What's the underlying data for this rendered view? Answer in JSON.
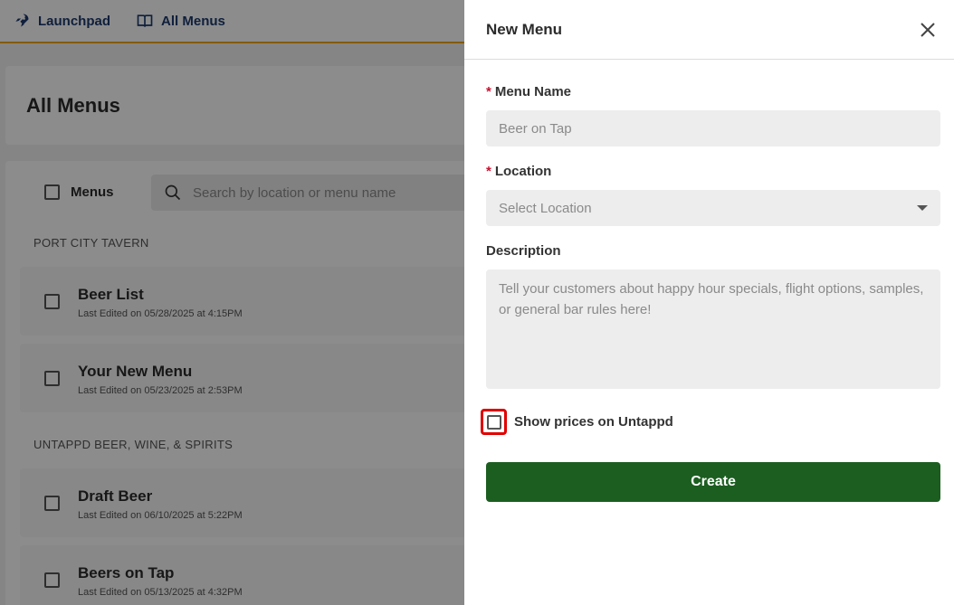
{
  "nav": {
    "launchpad_label": "Launchpad",
    "all_menus_label": "All Menus"
  },
  "page": {
    "title": "All Menus"
  },
  "list": {
    "select_all_label": "Menus",
    "search_placeholder": "Search by location or menu name",
    "groups": [
      {
        "label": "PORT CITY TAVERN",
        "menus": [
          {
            "name": "Beer List",
            "edited": "Last Edited on 05/28/2025 at 4:15PM"
          },
          {
            "name": "Your New Menu",
            "edited": "Last Edited on 05/23/2025 at 2:53PM"
          }
        ]
      },
      {
        "label": "UNTAPPD BEER, WINE, & SPIRITS",
        "menus": [
          {
            "name": "Draft Beer",
            "edited": "Last Edited on 06/10/2025 at 5:22PM"
          },
          {
            "name": "Beers on Tap",
            "edited": "Last Edited on 05/13/2025 at 4:32PM"
          }
        ]
      }
    ]
  },
  "drawer": {
    "title": "New Menu",
    "required_mark": "*",
    "menu_name_label": "Menu Name",
    "menu_name_placeholder": "Beer on Tap",
    "location_label": "Location",
    "location_placeholder": "Select Location",
    "description_label": "Description",
    "description_placeholder": "Tell your customers about happy hour specials, flight options, samples, or general bar rules here!",
    "show_prices_label": "Show prices on Untappd",
    "show_prices_checked": false,
    "create_label": "Create"
  },
  "colors": {
    "accent_border": "#f0a41a",
    "primary_button": "#1b5e20",
    "highlight": "#e00000",
    "nav_text": "#1d3a6e"
  }
}
